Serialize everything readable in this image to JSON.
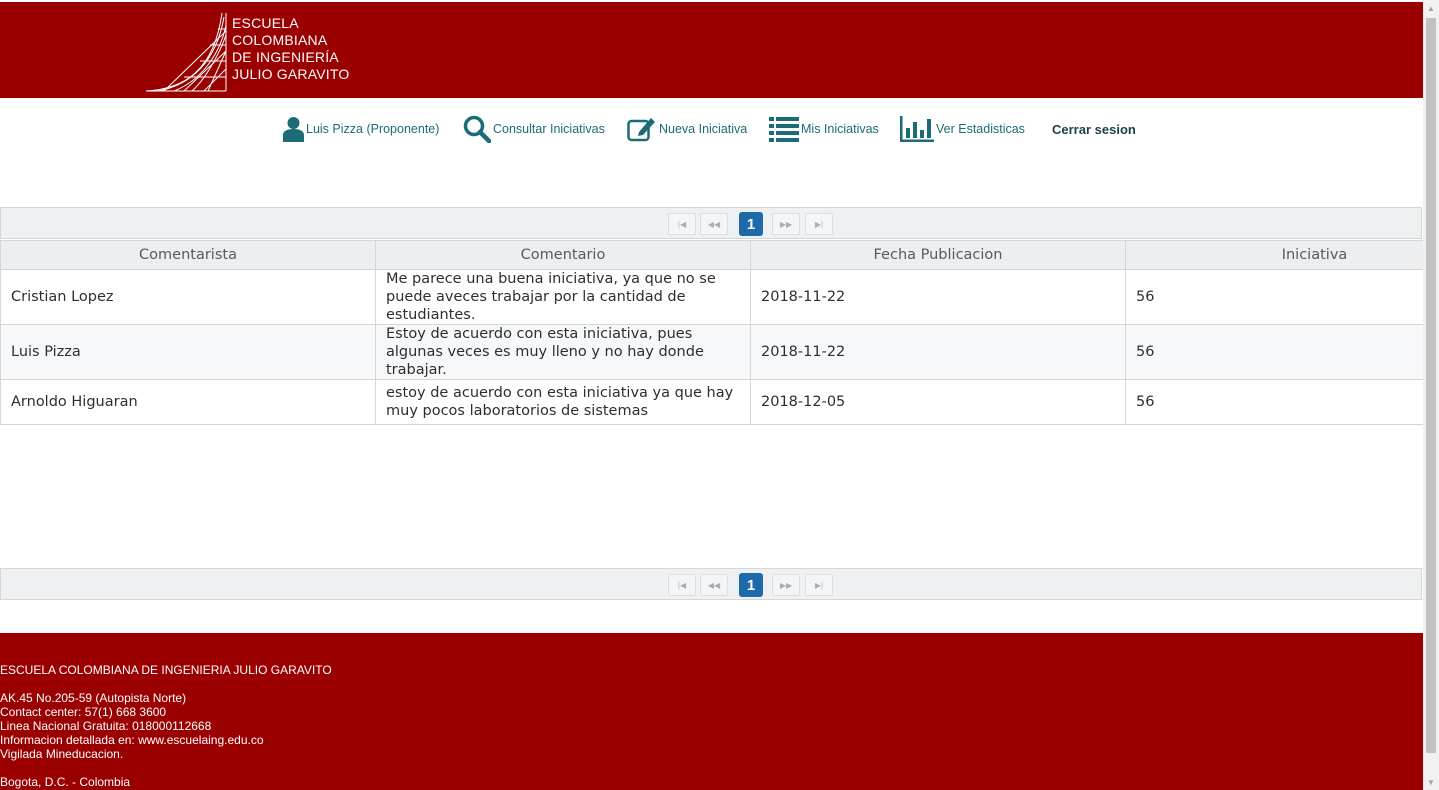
{
  "header": {
    "logo_lines": [
      "ESCUELA",
      "COLOMBIANA",
      "DE INGENIERÍA",
      "JULIO GARAVITO"
    ]
  },
  "nav": {
    "user": "Luis Pizza (Proponente)",
    "consultar": "Consultar Iniciativas",
    "nueva": "Nueva Iniciativa",
    "mis": "Mis Iniciativas",
    "estadisticas": "Ver Estadisticas",
    "cerrar": "Cerrar sesion"
  },
  "paginator": {
    "current_page": "1",
    "first_icon": "first-page-icon",
    "prev_icon": "previous-page-icon",
    "next_icon": "next-page-icon",
    "last_icon": "last-page-icon"
  },
  "table": {
    "headers": [
      "Comentarista",
      "Comentario",
      "Fecha Publicacion",
      "Iniciativa"
    ],
    "rows": [
      {
        "comentarista": "Cristian Lopez",
        "comentario": "Me parece una buena iniciativa, ya que no se puede aveces trabajar por la cantidad de estudiantes.",
        "fecha": "2018-11-22",
        "iniciativa": "56"
      },
      {
        "comentarista": "Luis Pizza",
        "comentario": "Estoy de acuerdo con esta iniciativa, pues algunas veces es muy lleno y no hay donde trabajar.",
        "fecha": "2018-11-22",
        "iniciativa": "56"
      },
      {
        "comentarista": "Arnoldo Higuaran",
        "comentario": "estoy de acuerdo con esta iniciativa ya que hay muy pocos laboratorios de sistemas",
        "fecha": "2018-12-05",
        "iniciativa": "56"
      }
    ]
  },
  "footer": {
    "name": "ESCUELA COLOMBIANA DE INGENIERIA JULIO GARAVITO",
    "address": "AK.45 No.205-59 (Autopista Norte)",
    "contact": "Contact center: 57(1) 668 3600",
    "linea": "Linea Nacional Gratuita: 018000112668",
    "info": "Informacion detallada en: www.escuelaing.edu.co",
    "vigilada": "Vigilada Mineducacion.",
    "city": "Bogota, D.C. - Colombia"
  },
  "colors": {
    "brand_red": "#9b0000",
    "nav_teal": "#1b6c77",
    "page_active": "#1e6aa8"
  }
}
